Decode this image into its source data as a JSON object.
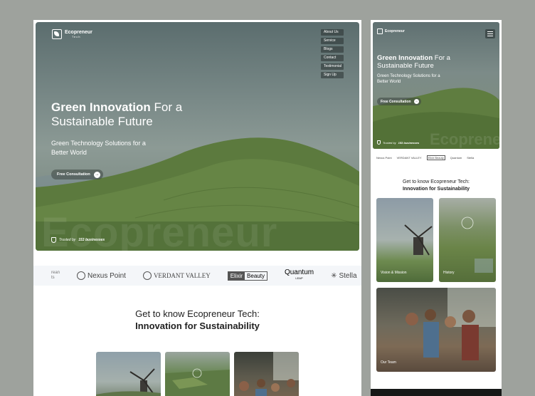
{
  "brand": {
    "name": "Ecopreneur",
    "sub": "Tech"
  },
  "nav": [
    "About Us",
    "Service",
    "Blogs",
    "Contact",
    "Testimonial",
    "Sign Up"
  ],
  "hero": {
    "title_bold": "Green Innovation",
    "title_rest": " For a Sustainable Future",
    "subtitle": "Green Technology Solutions for a Better World",
    "cta": "Free Consultation",
    "cta_icon": "arrow-right-icon",
    "watermark": "Ecopreneur",
    "trusted_prefix": "Trusted by ",
    "trusted_count": "153 businesses"
  },
  "logos": {
    "partial": "rean\nts",
    "nexus": "Nexus Point",
    "verdant": "VERDANT VALLEY",
    "elixir_a": "Elixir",
    "elixir_b": "Beauty",
    "quantum": "Quantum",
    "quantum_sub": "LEAP",
    "stella": "Stella"
  },
  "about": {
    "line1": "Get to know Ecopreneur Tech:",
    "line2": "Innovation for Sustainability"
  },
  "mobile": {
    "cards": [
      "Vision & Mission",
      "History",
      "Our Team"
    ],
    "logos": [
      "Nexus Point",
      "VERDANT VALLEY",
      "Elixir Beauty",
      "Quantum",
      "Stella"
    ]
  }
}
